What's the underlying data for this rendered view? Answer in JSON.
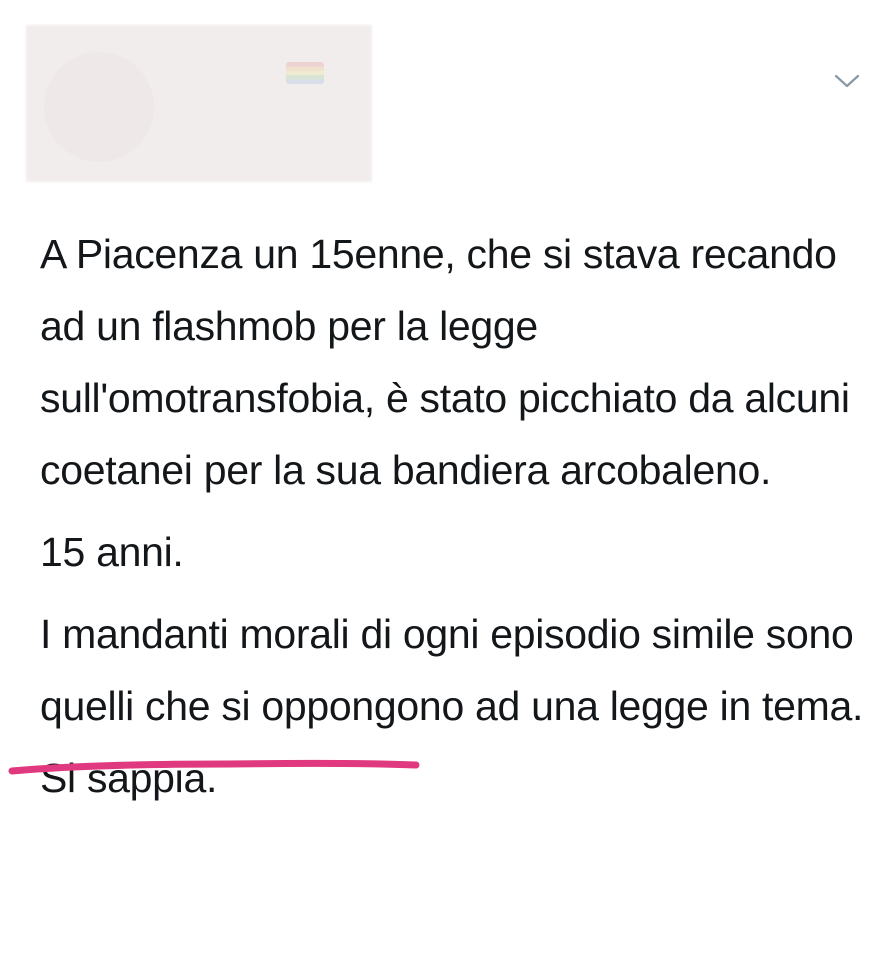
{
  "tweet": {
    "paragraphs": [
      "A Piacenza un 15enne, che si stava recando ad un flashmob per la legge sull'omotransfobia, è stato picchiato da alcuni coetanei per la sua bandiera arcobaleno.",
      "15 anni.",
      "I mandanti morali di ogni episodio simile sono quelli che si oppongono ad una legge in tema. Si sappia."
    ]
  },
  "colors": {
    "text": "#14171a",
    "underline": "#e0397f",
    "chevron": "#8899a6",
    "blurred_header": "#f2eded"
  },
  "icons": {
    "menu": "chevron-down-icon"
  }
}
